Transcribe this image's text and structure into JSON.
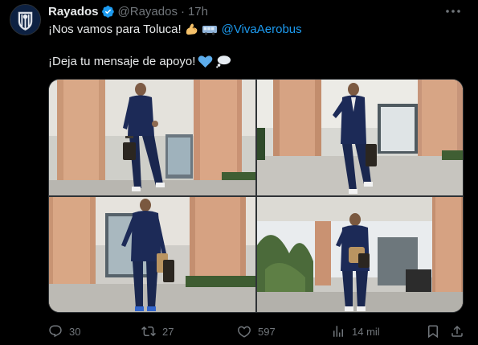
{
  "tweet": {
    "author_name": "Rayados",
    "handle": "@Rayados",
    "separator": "·",
    "time": "17h",
    "line1_text": "¡Nos vamos para Toluca!",
    "mention": "@VivaAerobus",
    "line2_text": "¡Deja tu mensaje de apoyo!"
  },
  "icons": {
    "verified": "verified-badge-icon",
    "more": "more-options-icon",
    "emoji_line1": [
      "flexed-biceps-emoji",
      "bus-emoji"
    ],
    "emoji_line2": [
      "blue-heart-emoji",
      "thought-balloon-emoji"
    ]
  },
  "colors": {
    "background": "#000000",
    "text": "#e7e9ea",
    "secondary": "#71767b",
    "accent": "#1d9bf0",
    "border": "#2f3336"
  },
  "actions": {
    "replies": "30",
    "reposts": "27",
    "likes": "597",
    "views": "14 mil"
  }
}
